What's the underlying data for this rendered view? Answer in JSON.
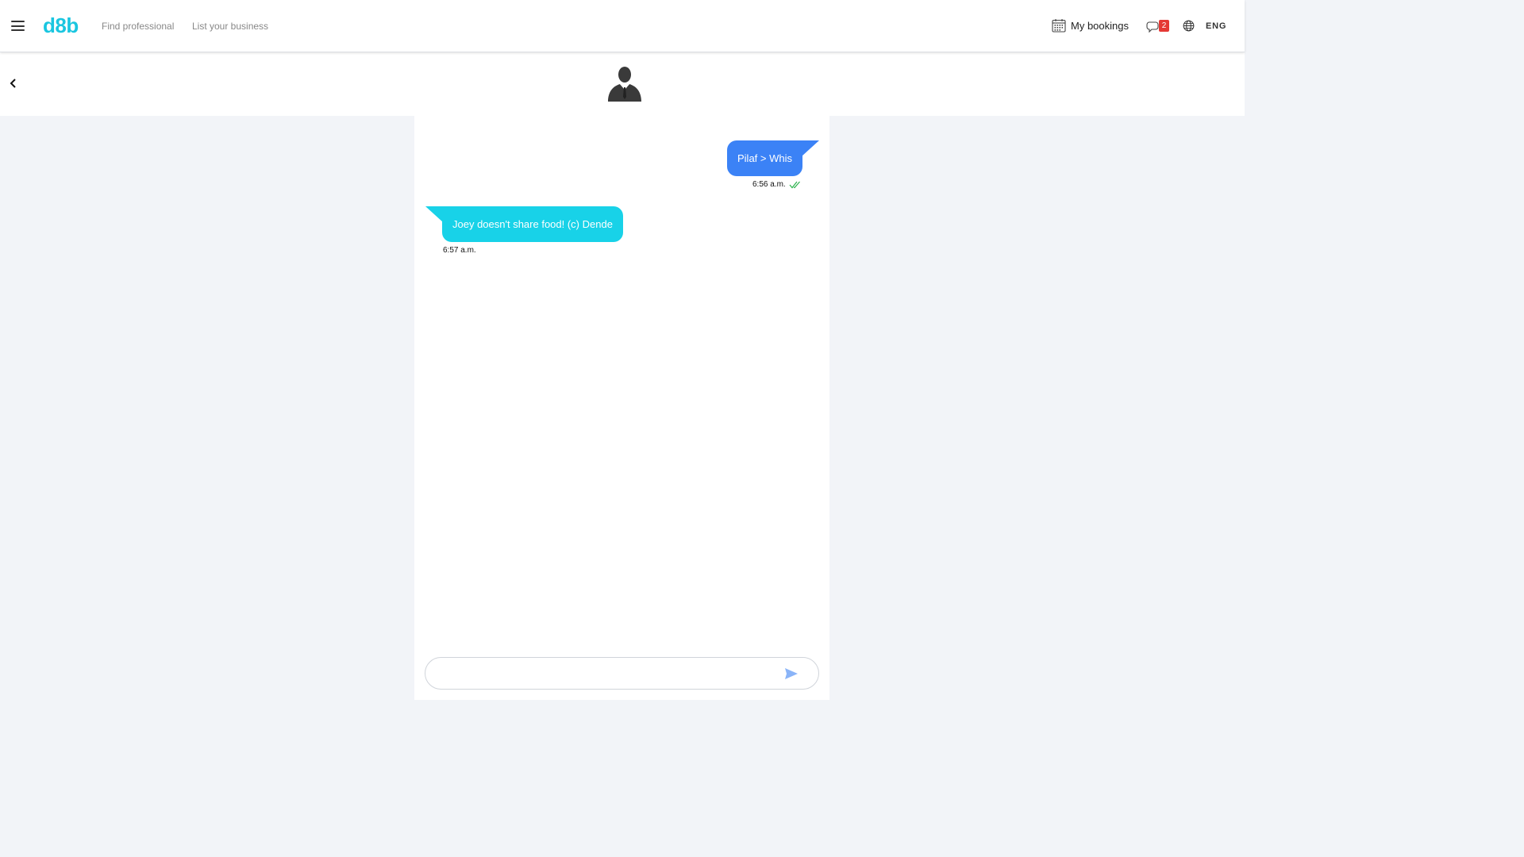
{
  "brand": {
    "logo_text": "d8b",
    "logo_color": "#1ac6e0"
  },
  "nav": {
    "find_professional": "Find professional",
    "list_business": "List your business"
  },
  "header_right": {
    "bookings_label": "My bookings",
    "bookings_icon": "calendar-icon",
    "chat_icon": "chat-bubbles-icon",
    "unread_count": "2",
    "globe_icon": "globe-icon",
    "language": "ENG"
  },
  "conversation": {
    "back_icon": "chevron-left-icon",
    "avatar_icon": "person-silhouette-icon",
    "messages": [
      {
        "direction": "outgoing",
        "text": "Pilaf > Whis",
        "time": "6:56 a.m.",
        "status_icon": "double-check-icon",
        "color": "#3b82f6"
      },
      {
        "direction": "incoming",
        "text": "Joey doesn't share food! (c) Dende",
        "time": "6:57 a.m.",
        "color": "#18d2e8"
      }
    ]
  },
  "composer": {
    "placeholder": "",
    "send_icon": "send-icon"
  },
  "colors": {
    "page_bg": "#f2f4f8",
    "badge": "#e53935",
    "read_check": "#2bb24c"
  }
}
